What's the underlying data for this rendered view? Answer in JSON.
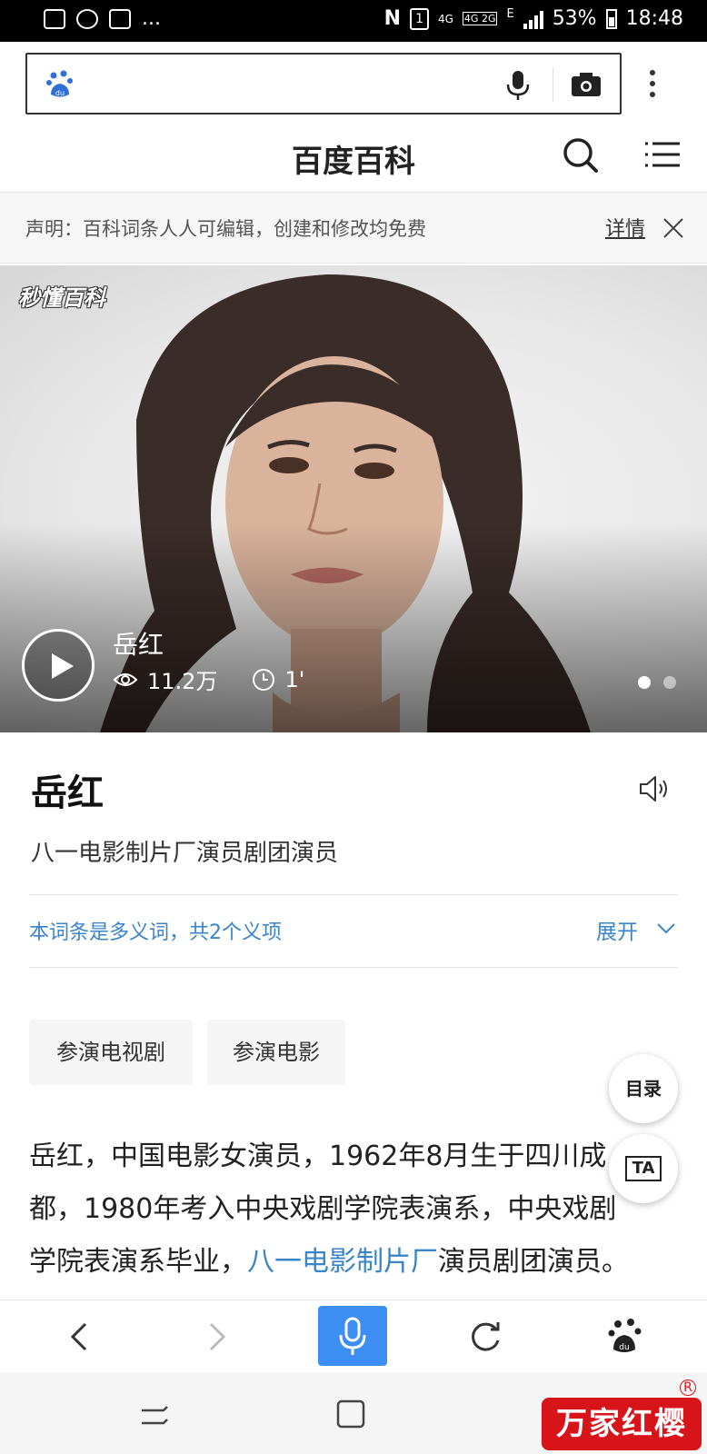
{
  "status_bar": {
    "dots": "...",
    "sim_badge": "1",
    "net_4g": "4G",
    "net_4g2g": "4G 2G",
    "net_e": "E",
    "battery": "53%",
    "time": "18:48"
  },
  "address_bar": {
    "logo_icon": "baidu-paw-icon",
    "voice_icon": "microphone-icon",
    "camera_icon": "camera-icon",
    "menu_icon": "more-vertical-icon"
  },
  "header": {
    "title": "百度百科",
    "search_icon": "search-icon",
    "menu_icon": "menu-icon"
  },
  "notice": {
    "text": "声明：百科词条人人可编辑，创建和修改均免费",
    "link": "详情"
  },
  "hero": {
    "logo": "秒懂百科",
    "video_title": "岳红",
    "views": "11.2万",
    "duration": "1'",
    "slides": 2,
    "active_slide": 1
  },
  "entry": {
    "title": "岳红",
    "subtitle": "八一电影制片厂演员剧团演员",
    "polysemy": "本词条是多义词，共2个义项",
    "expand": "展开"
  },
  "tags": [
    "参演电视剧",
    "参演电影"
  ],
  "floating": {
    "toc": "目录",
    "font": "TA"
  },
  "paragraph": {
    "line1": "岳红，中国电影女演员，1962年8月生于四川成",
    "line2": "都，1980年考入中央戏剧学院表演系，中央戏剧",
    "line3_pre": "学院表演系毕业，",
    "line3_link": "八一电影制片厂",
    "line3_post": "演员剧团演员。"
  },
  "watermark": {
    "text": "万家红樱",
    "registered": "R"
  },
  "colors": {
    "accent_blue": "#3a84c9",
    "mic_button": "#3d8ef2",
    "watermark_red": "#d8141b"
  }
}
